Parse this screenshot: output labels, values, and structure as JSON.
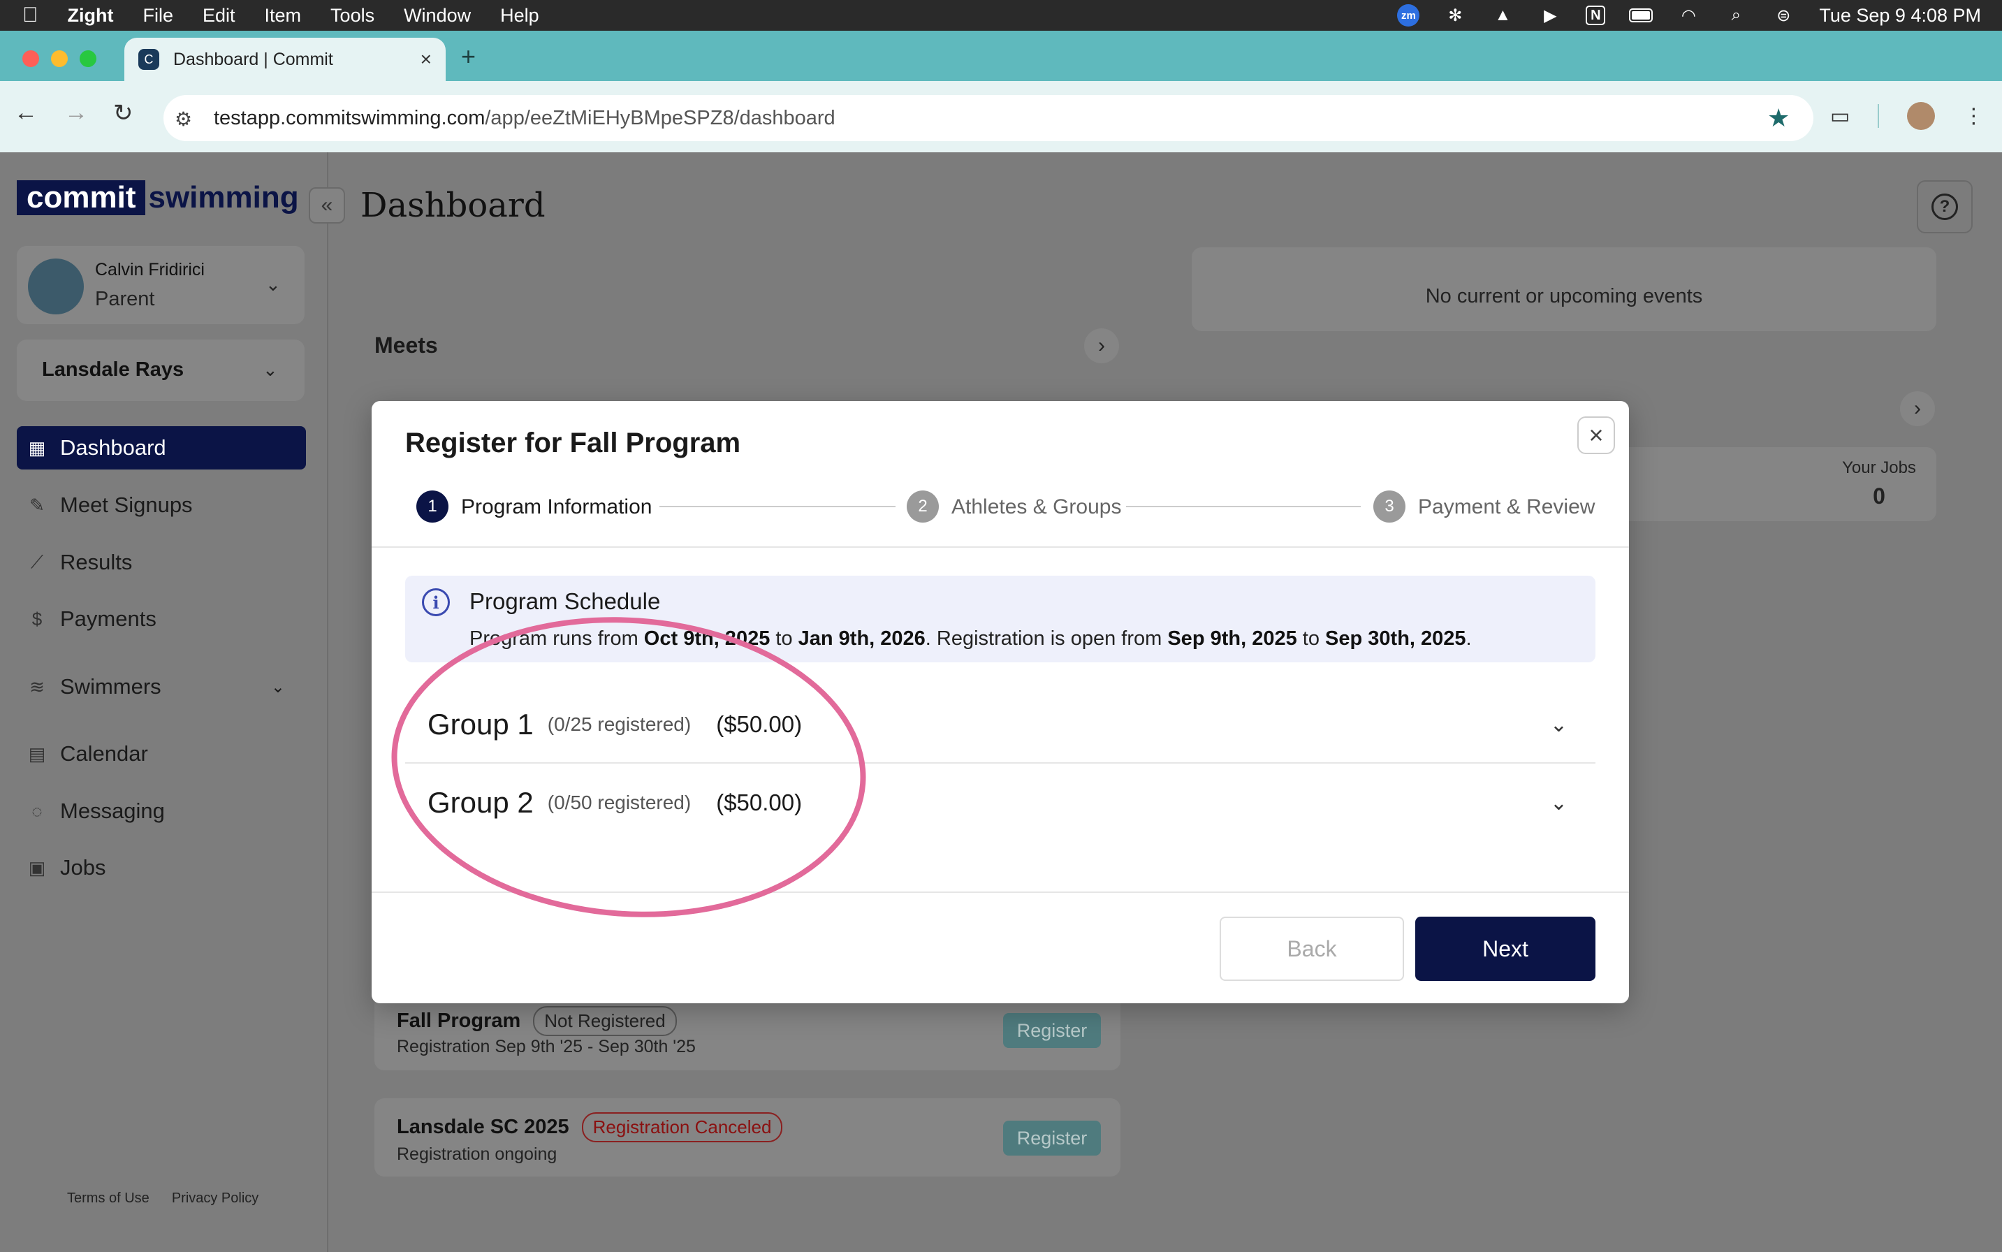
{
  "menubar": {
    "apple": "",
    "app": "Zight",
    "items": [
      "File",
      "Edit",
      "Item",
      "Tools",
      "Window",
      "Help"
    ],
    "status_icons": [
      "zoom-icon",
      "snowflake-icon",
      "warning-icon",
      "play-icon",
      "notion-icon",
      "battery-icon",
      "wifi-icon",
      "search-icon",
      "control-center-icon"
    ],
    "zoom_label": "zm",
    "notion_label": "N",
    "datetime": "Tue Sep 9  4:08 PM"
  },
  "browser": {
    "tab_title": "Dashboard | Commit",
    "url_host": "testapp.commitswimming.com",
    "url_path": "/app/eeZtMiEHyBMpeSPZ8/dashboard",
    "new_tab": "+",
    "tab_close": "×"
  },
  "sidebar": {
    "logo_left": "commit",
    "logo_right": "swimming",
    "collapse": "«",
    "user_name": "Calvin Fridirici",
    "user_role": "Parent",
    "team": "Lansdale Rays",
    "nav": [
      {
        "label": "Dashboard",
        "icon": "grid-icon"
      },
      {
        "label": "Meet Signups",
        "icon": "signup-icon"
      },
      {
        "label": "Results",
        "icon": "chart-icon"
      },
      {
        "label": "Payments",
        "icon": "payment-icon"
      },
      {
        "label": "Swimmers",
        "icon": "swimmers-icon"
      },
      {
        "label": "Calendar",
        "icon": "calendar-icon"
      },
      {
        "label": "Messaging",
        "icon": "chat-icon"
      },
      {
        "label": "Jobs",
        "icon": "jobs-icon"
      }
    ],
    "footer": {
      "terms": "Terms of Use",
      "privacy": "Privacy Policy"
    }
  },
  "main": {
    "title": "Dashboard",
    "meets_title": "Meets",
    "events_empty": "No current or upcoming events",
    "jobs_label": "Your Jobs",
    "jobs_value": "0",
    "programs": [
      {
        "name": "Fall Program",
        "badge": "Not Registered",
        "sub": "Registration Sep 9th '25 - Sep 30th '25",
        "button": "Register"
      },
      {
        "name": "Lansdale SC 2025",
        "badge": "Registration Canceled",
        "sub": "Registration ongoing",
        "button": "Register"
      }
    ]
  },
  "modal": {
    "title": "Register for Fall Program",
    "close": "×",
    "steps": [
      {
        "num": "1",
        "label": "Program Information"
      },
      {
        "num": "2",
        "label": "Athletes & Groups"
      },
      {
        "num": "3",
        "label": "Payment & Review"
      }
    ],
    "info": {
      "title": "Program Schedule",
      "t1": "Program runs from ",
      "start": "Oct 9th, 2025",
      "t2": " to ",
      "end": "Jan 9th, 2026",
      "t3": ". Registration is open from ",
      "reg_start": "Sep 9th, 2025",
      "t4": " to ",
      "reg_end": "Sep 30th, 2025",
      "t5": "."
    },
    "groups": [
      {
        "name": "Group 1",
        "count": "(0/25 registered)",
        "price": "($50.00)"
      },
      {
        "name": "Group 2",
        "count": "(0/50 registered)",
        "price": "($50.00)"
      }
    ],
    "back": "Back",
    "next": "Next"
  },
  "colors": {
    "brand_navy": "#0b1446",
    "tab_teal": "#5fb9bd",
    "annotation_pink": "#e26a9a"
  }
}
